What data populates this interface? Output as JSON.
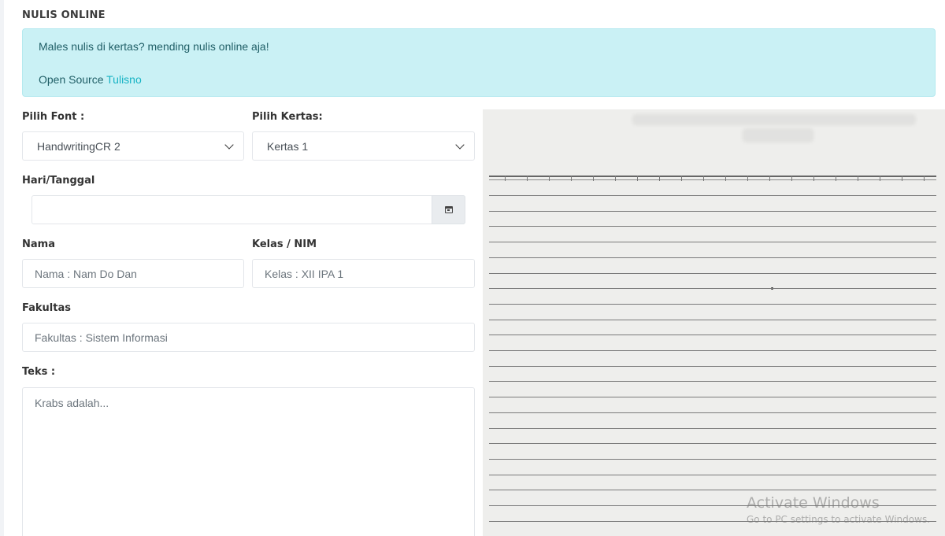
{
  "header": {
    "title": "NULIS ONLINE"
  },
  "alert": {
    "message": "Males nulis di kertas? mending nulis online aja!",
    "source_prefix": "Open Source",
    "source_link": "Tulisno"
  },
  "form": {
    "font_label": "Pilih Font :",
    "font_selected": "HandwritingCR 2",
    "paper_label": "Pilih Kertas:",
    "paper_selected": "Kertas 1",
    "date_label": "Hari/Tanggal",
    "date_value": "",
    "date_icon": "calendar-icon",
    "name_label": "Nama",
    "name_placeholder": "Nama : Nam Do Dan",
    "class_label": "Kelas / NIM",
    "class_placeholder": "Kelas : XII IPA 1",
    "faculty_label": "Fakultas",
    "faculty_placeholder": "Fakultas : Sistem Informasi",
    "text_label": "Teks :",
    "text_placeholder": "Krabs adalah..."
  },
  "watermark": {
    "line1": "Activate Windows",
    "line2": "Go to PC settings to activate Windows."
  }
}
